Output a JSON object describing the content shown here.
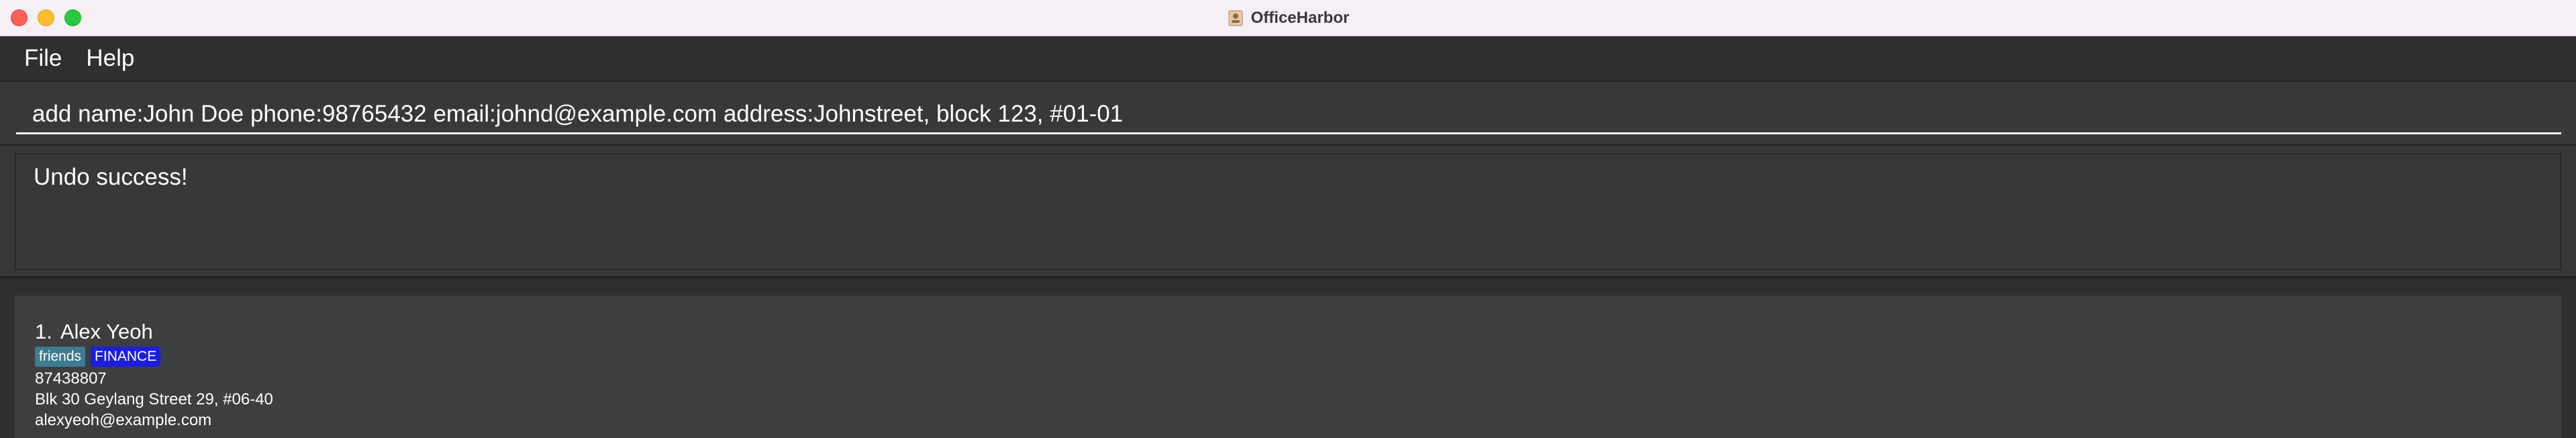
{
  "window": {
    "title": "OfficeHarbor",
    "app_icon": "contact-card-icon"
  },
  "menu": {
    "items": [
      "File",
      "Help"
    ]
  },
  "command": {
    "value": "add name:John Doe phone:98765432 email:johnd@example.com address:Johnstreet, block 123, #01-01"
  },
  "result": {
    "message": "Undo success!"
  },
  "persons": [
    {
      "index": "1.",
      "name": "Alex Yeoh",
      "tags": [
        "friends",
        "FINANCE"
      ],
      "phone": "87438807",
      "address": "Blk 30 Geylang Street 29, #06-40",
      "email": "alexyeoh@example.com"
    }
  ],
  "colors": {
    "titlebar": "#f6f0f6",
    "background": "#2f2f2f",
    "panel": "#383838",
    "card": "#3c3e3f",
    "tag_friends": "#3e7b91",
    "tag_finance": "#1b1fdc",
    "close": "#fe5f57",
    "minimize": "#febc2e",
    "maximize": "#28c840"
  }
}
